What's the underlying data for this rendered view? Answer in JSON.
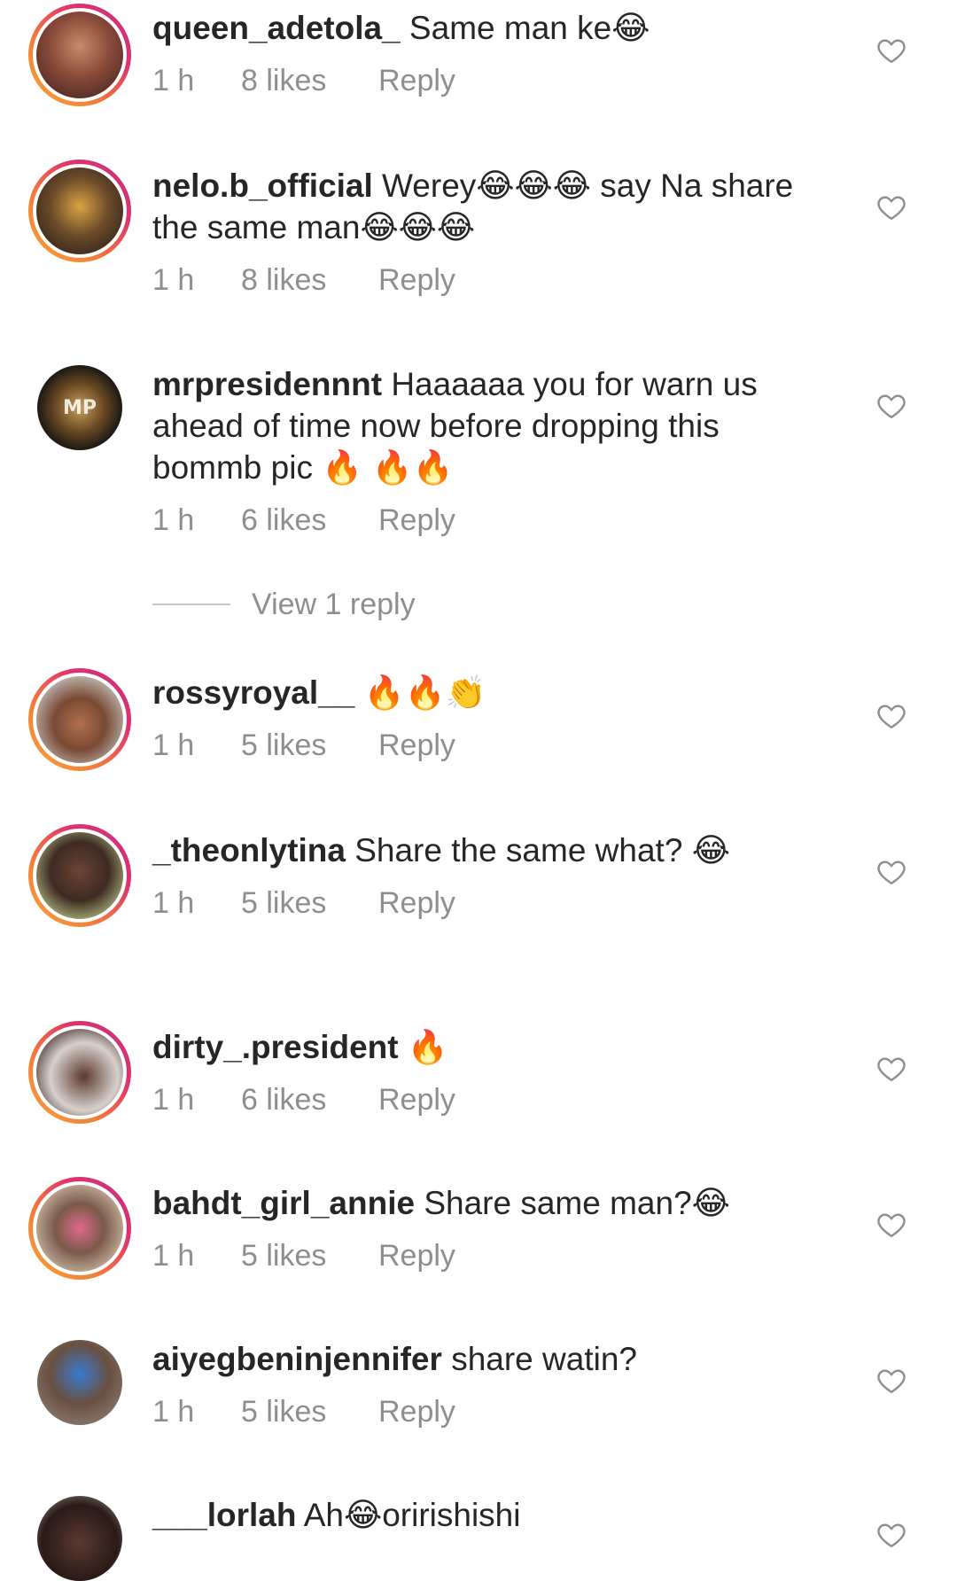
{
  "comments": [
    {
      "username": "queen_adetola_",
      "text": " Same man ke😂",
      "time": "1 h",
      "likes": "8 likes",
      "reply": "Reply"
    },
    {
      "username": "nelo.b_official",
      "text": " Werey😂😂😂 say Na share the same man😂😂😂",
      "time": "1 h",
      "likes": "8 likes",
      "reply": "Reply"
    },
    {
      "username": "mrpresidennnt",
      "text": " Haaaaaa you for warn us ahead of time now before dropping this bommb pic 🔥 🔥🔥",
      "time": "1 h",
      "likes": "6 likes",
      "reply": "Reply"
    },
    {
      "username": "rossyroyal__",
      "text": " 🔥🔥👏",
      "time": "1 h",
      "likes": "5 likes",
      "reply": "Reply"
    },
    {
      "username": "_theonlytina",
      "text": " Share the same what? 😂",
      "time": "1 h",
      "likes": "5 likes",
      "reply": "Reply"
    },
    {
      "username": "dirty_.president",
      "text": " 🔥",
      "time": "1 h",
      "likes": "6 likes",
      "reply": "Reply"
    },
    {
      "username": "bahdt_girl_annie",
      "text": " Share same man?😂",
      "time": "1 h",
      "likes": "5 likes",
      "reply": "Reply"
    },
    {
      "username": "aiyegbeninjennifer",
      "text": " share watin?",
      "time": "1 h",
      "likes": "5 likes",
      "reply": "Reply"
    },
    {
      "username": "___lorlah",
      "text": " Ah😂oririshishi",
      "time": "",
      "likes": "",
      "reply": ""
    }
  ],
  "view_replies": "View 1 reply",
  "icons": {
    "heart": "heart-outline-icon",
    "avatar": "avatar"
  },
  "colors": {
    "text": "#262626",
    "meta": "#8e8e8e",
    "story_ring": [
      "#f9a43b",
      "#e1306c",
      "#c13584"
    ]
  }
}
